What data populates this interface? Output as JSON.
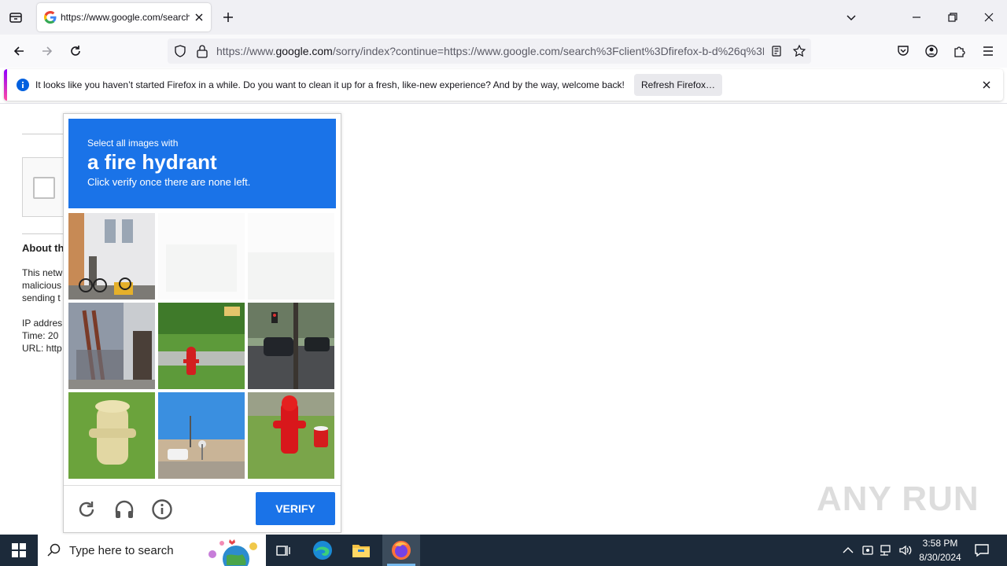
{
  "browser": {
    "tab": {
      "title": "https://www.google.com/search"
    },
    "url": {
      "prefix": "https://www.",
      "host": "google.com",
      "rest": "/sorry/index?continue=https://www.google.com/search%3Fclient%3Dfirefox-b-d%26q%3D"
    },
    "notification": {
      "message": "It looks like you haven’t started Firefox in a while. Do you want to clean it up for a fresh, like-new experience? And by the way, welcome back!",
      "button": "Refresh Firefox…"
    }
  },
  "page_behind": {
    "heading": "About th",
    "lines": [
      "This netw",
      "malicious",
      "sending t"
    ],
    "meta": [
      "IP addres",
      "Time: 20",
      "URL: http"
    ]
  },
  "captcha": {
    "instruction_small": "Select all images with",
    "target": "a fire hydrant",
    "instruction_sub": "Click verify once there are none left.",
    "verify_label": "VERIFY"
  },
  "taskbar": {
    "search_placeholder": "Type here to search",
    "time": "3:58 PM",
    "date": "8/30/2024"
  },
  "watermark": "ANY RUN",
  "colors": {
    "accent": "#1a73e8",
    "taskbar": "#1c2a3a"
  }
}
